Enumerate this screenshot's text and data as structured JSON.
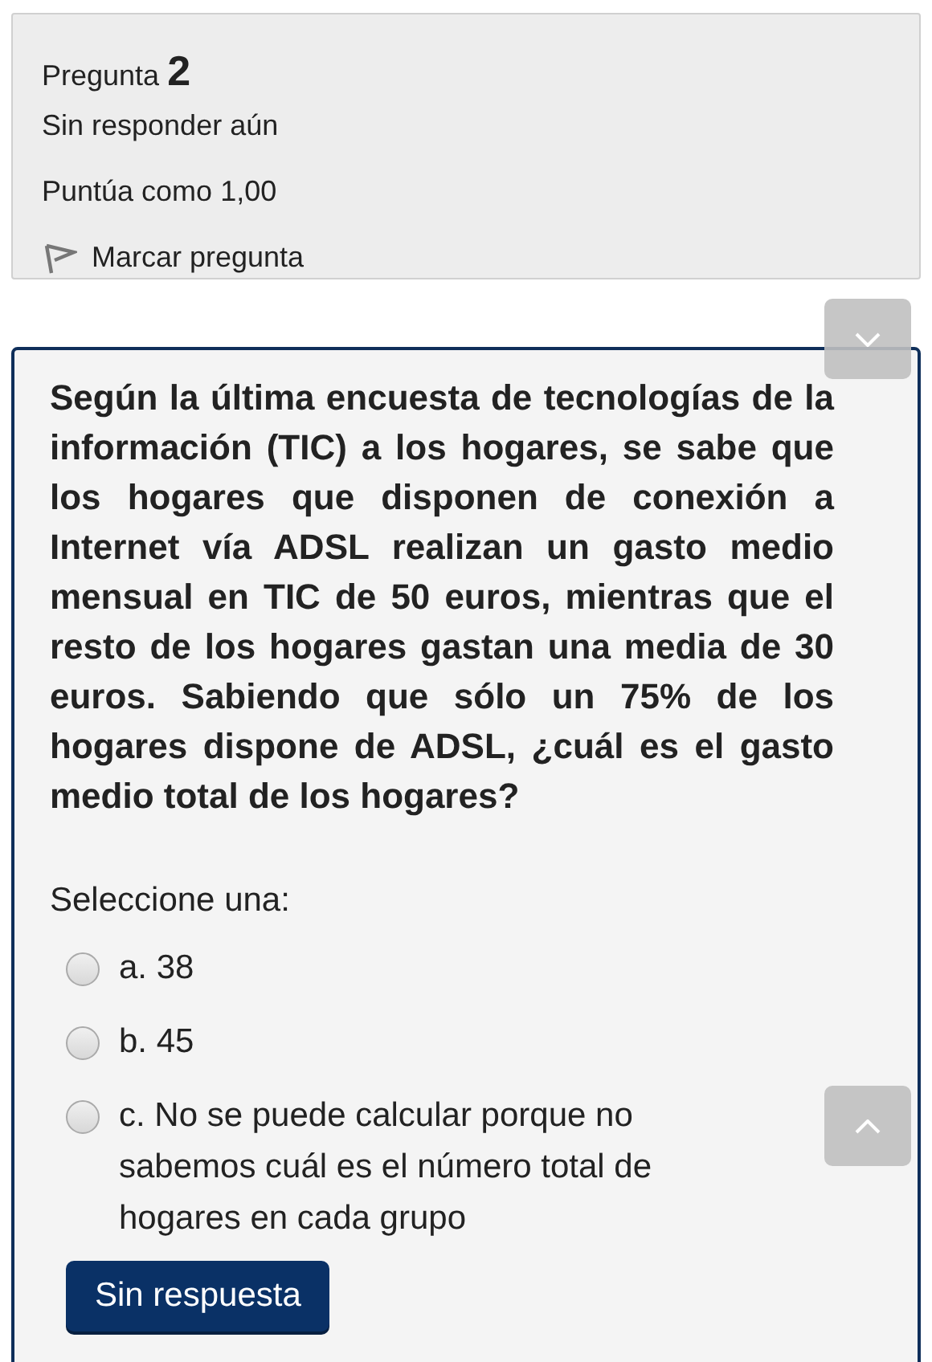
{
  "info": {
    "label": "Pregunta",
    "number": "2",
    "status": "Sin responder aún",
    "grade": "Puntúa como 1,00",
    "flag": {
      "label": "Marcar pregunta",
      "flagged": false
    }
  },
  "question": {
    "text": "Según la última encuesta de tecnologías de la información (TIC) a los hogares, se sabe que los hogares que disponen de conexión a Internet vía ADSL realizan un gasto medio mensual en TIC de 50 euros, mientras que el resto de los hogares gastan una media de 30 euros. Sabiendo que sólo un 75% de los hogares dispone de ADSL, ¿cuál es el gasto medio total de los hogares?",
    "prompt": "Seleccione una:",
    "options": [
      {
        "label": "a. 38",
        "selected": false
      },
      {
        "label": "b. 45",
        "selected": false
      },
      {
        "label": "c. No se puede calcular porque no sabemos cuál es el número total de hogares en cada grupo",
        "selected": false
      }
    ],
    "clear_button": "Sin respuesta"
  }
}
